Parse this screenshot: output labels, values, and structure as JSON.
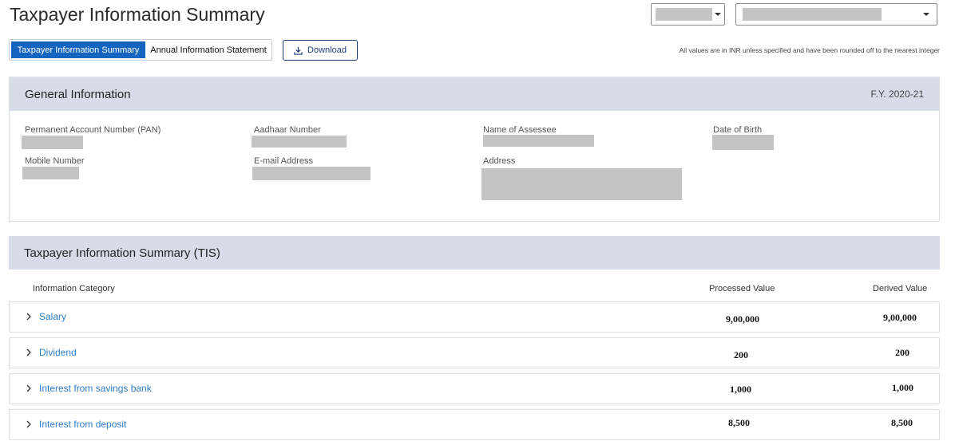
{
  "header": {
    "title": "Taxpayer Information Summary"
  },
  "tabs": [
    {
      "label": "Taxpayer Information Summary",
      "active": true
    },
    {
      "label": "Annual Information Statement",
      "active": false
    }
  ],
  "toolbar": {
    "download_label": "Download",
    "download_icon": "download-icon"
  },
  "note": "All values are in INR unless specified and have been rounded off to the nearest integer",
  "general": {
    "title": "General Information",
    "fy": "F.Y. 2020-21",
    "fields": {
      "pan": "Permanent Account Number (PAN)",
      "aadhaar": "Aadhaar Number",
      "name": "Name of Assessee",
      "dob": "Date of Birth",
      "mobile": "Mobile Number",
      "email": "E-mail Address",
      "address": "Address"
    }
  },
  "tis": {
    "title": "Taxpayer Information Summary (TIS)",
    "columns": {
      "category": "Information Category",
      "processed": "Processed Value",
      "derived": "Derived Value"
    },
    "rows": [
      {
        "label": "Salary",
        "processed": "9,00,000",
        "derived": "9,00,000"
      },
      {
        "label": "Dividend",
        "processed": "200",
        "derived": "200"
      },
      {
        "label": "Interest from savings bank",
        "processed": "1,000",
        "derived": "1,000"
      },
      {
        "label": "Interest from deposit",
        "processed": "8,500",
        "derived": "8,500"
      }
    ]
  },
  "colors": {
    "accent": "#1565c0",
    "header_band": "#d8dbe8",
    "link": "#2c7cc9"
  }
}
